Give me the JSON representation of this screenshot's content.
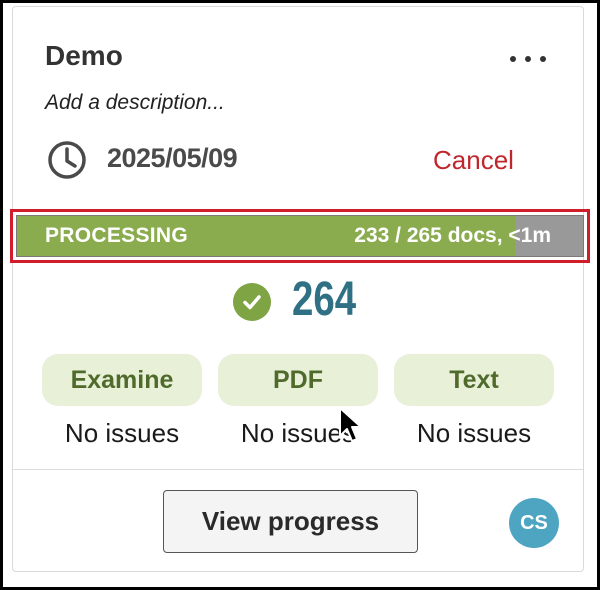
{
  "card": {
    "title": "Demo",
    "description": "Add a description...",
    "date": "2025/05/09",
    "cancel_label": "Cancel",
    "menu_icon": "more-horizontal-icon",
    "clock_icon": "clock-icon"
  },
  "progress": {
    "status": "PROCESSING",
    "count_text": "233 / 265 docs, <1m",
    "fraction": 0.879,
    "fill_color": "#8aac4e",
    "track_color": "#999999",
    "highlight_color": "#d01c2b"
  },
  "summary": {
    "total": "264",
    "check_icon": "check-circle-icon",
    "accent_color": "#2f7085"
  },
  "checks": [
    {
      "label": "Examine",
      "status": "No issues"
    },
    {
      "label": "PDF",
      "status": "No issues"
    },
    {
      "label": "Text",
      "status": "No issues"
    }
  ],
  "footer": {
    "view_progress_label": "View progress",
    "avatar_initials": "CS"
  }
}
